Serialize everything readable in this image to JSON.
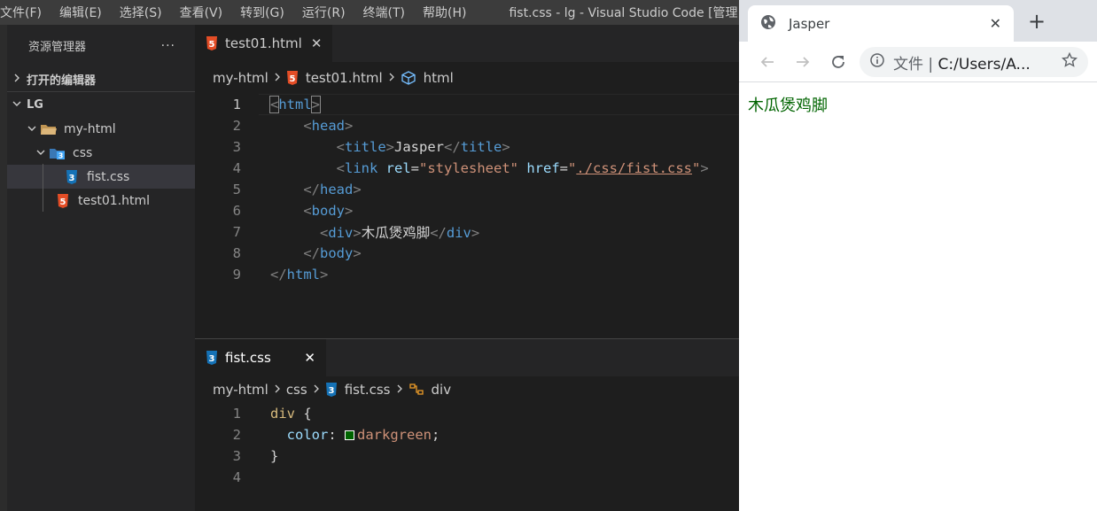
{
  "menubar": {
    "items": [
      "文件(F)",
      "编辑(E)",
      "选择(S)",
      "查看(V)",
      "转到(G)",
      "运行(R)",
      "终端(T)",
      "帮助(H)"
    ],
    "title": "fist.css - lg - Visual Studio Code [管理"
  },
  "explorer": {
    "title": "资源管理器",
    "more": "···",
    "open_editors": "打开的编辑器",
    "workspace": "LG",
    "tree": {
      "folder_root": "my-html",
      "folder_css": "css",
      "file_css": "fist.css",
      "file_html": "test01.html"
    }
  },
  "editor_top": {
    "tab_label": "test01.html",
    "breadcrumb": [
      "my-html",
      "test01.html",
      "html"
    ],
    "line_numbers": [
      "1",
      "2",
      "3",
      "4",
      "5",
      "6",
      "7",
      "8",
      "9"
    ]
  },
  "editor_bottom": {
    "tab_label": "fist.css",
    "breadcrumb": [
      "my-html",
      "css",
      "fist.css",
      "div"
    ],
    "line_numbers": [
      "1",
      "2",
      "3",
      "4"
    ]
  },
  "browser": {
    "tab_title": "Jasper",
    "address_label": "文件",
    "address_url": "C:/Users/A...",
    "page_text": "木瓜煲鸡脚",
    "page_text_color": "#006400"
  },
  "colors": {
    "html_icon": "#e44d26",
    "css_icon": "#1572b6",
    "swatch": "#006400"
  }
}
